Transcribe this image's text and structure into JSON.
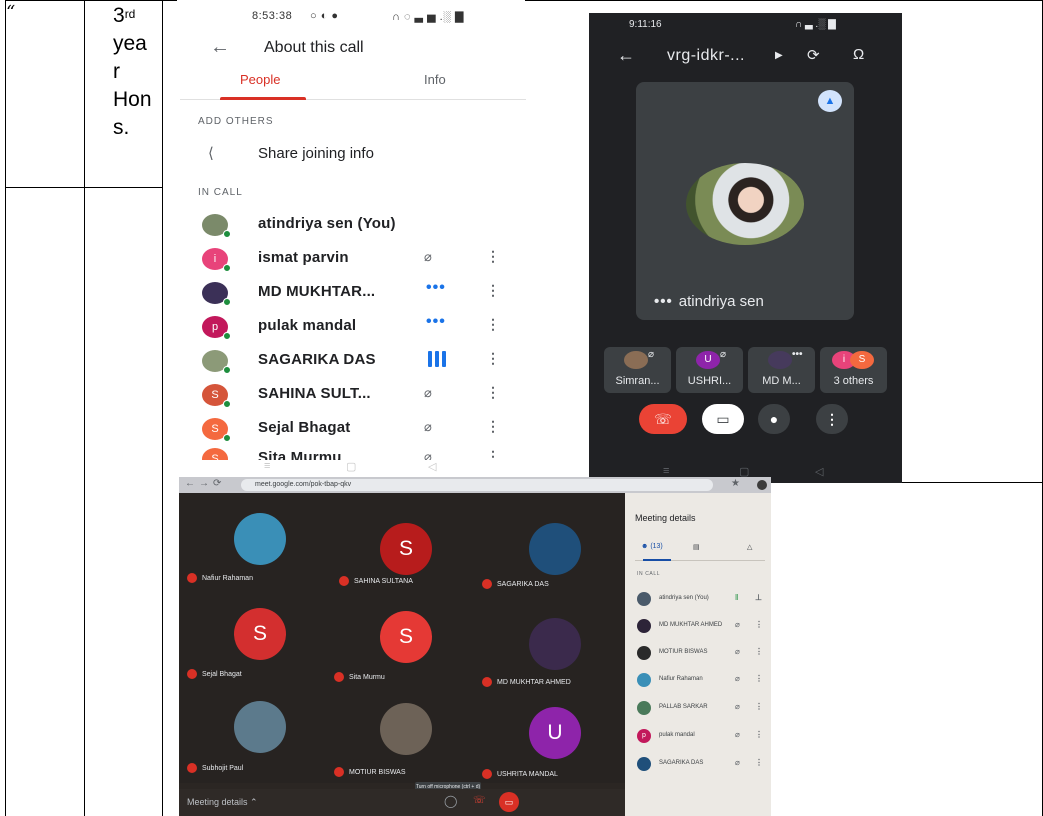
{
  "doc_table": {
    "quote_mark": "“",
    "year_num": "3",
    "year_sup": "rd",
    "year_lines": [
      "yea",
      "r",
      "Hon",
      "s."
    ]
  },
  "about_call": {
    "status_time": "8:53:38",
    "status_left_icons": "○ ◐ ●",
    "status_right_icons": "∩ ◌ ▃ ▅ .░ ▇",
    "title": "About this call",
    "tabs": [
      "People",
      "Info"
    ],
    "active_tab": "People",
    "add_others_label": "ADD OTHERS",
    "share_label": "Share joining info",
    "in_call_label": "IN CALL",
    "participants": [
      {
        "name": "atindriya sen (You)",
        "initial": "",
        "color": "#7b8a6a",
        "status": "none"
      },
      {
        "name": "ismat parvin",
        "initial": "i",
        "color": "#e8437a",
        "status": "muted"
      },
      {
        "name": "MD MUKHTAR...",
        "initial": "",
        "color": "#3b3057",
        "status": "dots"
      },
      {
        "name": "pulak mandal",
        "initial": "p",
        "color": "#c2185b",
        "status": "dots"
      },
      {
        "name": "SAGARIKA DAS",
        "initial": "",
        "color": "#8c9a78",
        "status": "speaking"
      },
      {
        "name": "SAHINA SULT...",
        "initial": "S",
        "color": "#d5553a",
        "status": "muted"
      },
      {
        "name": "Sejal Bhagat",
        "initial": "S",
        "color": "#f4693f",
        "status": "muted"
      },
      {
        "name": "Sita Murmu",
        "initial": "S",
        "color": "#f4693f",
        "status": "muted"
      }
    ],
    "colors": {
      "accent": "#d93025",
      "active_audio": "#1a73e8"
    }
  },
  "call_screen": {
    "status_time": "9:11:16",
    "status_right_icons": "∩ ▃ .░ ▇",
    "meeting_code": "vrg-idkr-...",
    "main_name": "atindriya sen",
    "thumbnails": [
      {
        "name": "Simran...",
        "initial": "",
        "color": "#8a6d55",
        "muted": true
      },
      {
        "name": "USHRI...",
        "initial": "U",
        "color": "#8e24aa",
        "muted": true
      },
      {
        "name": "MD M...",
        "initial": "",
        "color": "#463a5c",
        "muted": false
      },
      {
        "name": "3 others",
        "initial": "i",
        "color": "#e8437a",
        "muted": false
      }
    ],
    "colors": {
      "end_call": "#ea4335",
      "tile": "#3c4043"
    }
  },
  "meet_laptop": {
    "url": "meet.google.com/pok-tbap-qkv",
    "tiles": [
      {
        "name": "Nafiur Rahaman",
        "initial": "",
        "color": "#3a8fb7"
      },
      {
        "name": "SAHINA SULTANA",
        "initial": "S",
        "color": "#b71c1c"
      },
      {
        "name": "SAGARIKA DAS",
        "initial": "",
        "color": "#1f4f7a"
      },
      {
        "name": "Sejal Bhagat",
        "initial": "S",
        "color": "#d32f2f"
      },
      {
        "name": "Sita Murmu",
        "initial": "S",
        "color": "#e53935"
      },
      {
        "name": "MD MUKHTAR AHMED",
        "initial": "",
        "color": "#3b2a4c"
      },
      {
        "name": "Subhojit Paul",
        "initial": "",
        "color": "#5c7a8c"
      },
      {
        "name": "MOTIUR BISWAS",
        "initial": "",
        "color": "#6d6257"
      },
      {
        "name": "USHRITA MANDAL",
        "initial": "U",
        "color": "#8e24aa"
      }
    ],
    "tooltip": "Turn off microphone (ctrl + d)",
    "bottom_label": "Meeting details",
    "side_title": "Meeting details",
    "people_count": "(13)",
    "in_call_label": "IN CALL",
    "side_people": [
      {
        "name": "atindriya sen (You)",
        "initial": "",
        "color": "#4a5a6a"
      },
      {
        "name": "MD MUKHTAR AHMED",
        "initial": "",
        "color": "#2d2438"
      },
      {
        "name": "MOTIUR BISWAS",
        "initial": "",
        "color": "#2a2a2a"
      },
      {
        "name": "Nafiur Rahaman",
        "initial": "",
        "color": "#3a8fb7"
      },
      {
        "name": "PALLAB SARKAR",
        "initial": "",
        "color": "#4a7a5a"
      },
      {
        "name": "pulak mandal",
        "initial": "p",
        "color": "#c2185b"
      },
      {
        "name": "SAGARIKA DAS",
        "initial": "",
        "color": "#1f4f7a"
      }
    ]
  }
}
